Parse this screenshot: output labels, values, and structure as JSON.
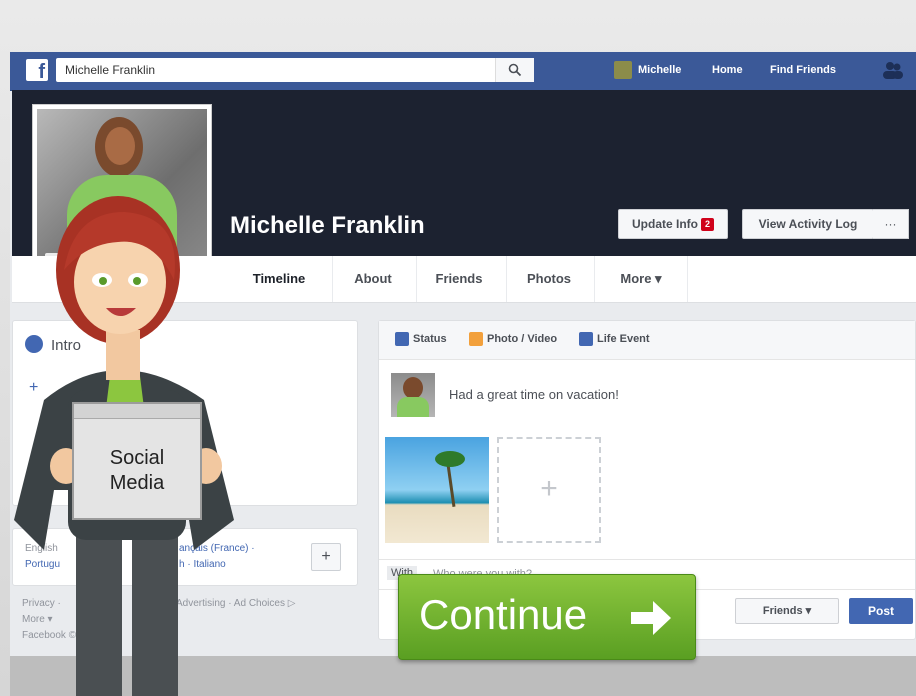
{
  "topbar": {
    "search_value": "Michelle Franklin",
    "user_name": "Michelle",
    "home": "Home",
    "find_friends": "Find Friends"
  },
  "profile": {
    "name": "Michelle Franklin",
    "update_info": "Update Info",
    "update_info_badge": "2",
    "view_activity_log": "View Activity Log",
    "more_dots": "···"
  },
  "tabs": [
    "Timeline",
    "About",
    "Friends",
    "Photos",
    "More ▾"
  ],
  "intro": {
    "title": "Intro",
    "add_icon": "+"
  },
  "languages": {
    "line1": "English",
    "line1b": "ançais (France) ·",
    "line2": "Portugu",
    "line2b": "h · Italiano",
    "add": "+"
  },
  "footer": {
    "line1a": "Privacy ·",
    "line1b": "Advertising · Ad Choices ▷",
    "line2": "More ▾",
    "line3": "Facebook ©"
  },
  "composer": {
    "status": "Status",
    "photo_video": "Photo / Video",
    "life_event": "Life Event",
    "post_text": "Had a great time on vacation!",
    "with_label": "With",
    "with_placeholder": "Who were you with?",
    "friends_dropdown": "Friends ▾",
    "post_button": "Post"
  },
  "sign": {
    "line1": "Social",
    "line2": "Media"
  },
  "continue": {
    "label": "Continue"
  },
  "colors": {
    "facebook_blue": "#3b5998",
    "continue_green": "#7ab51d",
    "cover_dark": "#1c2230"
  }
}
